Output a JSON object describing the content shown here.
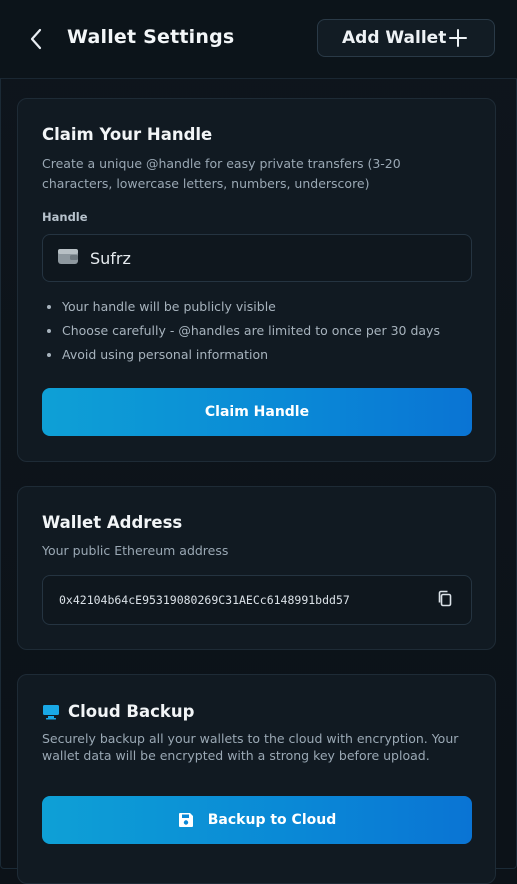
{
  "header": {
    "title": "Wallet Settings",
    "add_wallet_label": "Add Wallet"
  },
  "handle_card": {
    "title": "Claim Your Handle",
    "description": "Create a unique @handle for easy private transfers (3-20 characters, lowercase letters, numbers, underscore)",
    "field_label": "Handle",
    "input_value": "Sufrz",
    "bullets": [
      "Your handle will be publicly visible",
      "Choose carefully - @handles are limited to once per 30 days",
      "Avoid using personal information"
    ],
    "button_label": "Claim Handle"
  },
  "address_card": {
    "title": "Wallet Address",
    "description": "Your public Ethereum address",
    "address": "0x42104b64cE95319080269C31AECc6148991bdd57"
  },
  "backup_card": {
    "title": "Cloud Backup",
    "description": "Securely backup all your wallets to the cloud with encryption. Your wallet data will be encrypted with a strong key before upload.",
    "button_label": "Backup to Cloud"
  },
  "colors": {
    "background": "#0c1218",
    "card": "#111a22",
    "accent": "#0a88d6",
    "monitor_icon": "#19a8e6"
  },
  "icons": [
    "back-arrow-icon",
    "plus-icon",
    "wallet-icon",
    "copy-icon",
    "monitor-icon",
    "save-icon"
  ]
}
